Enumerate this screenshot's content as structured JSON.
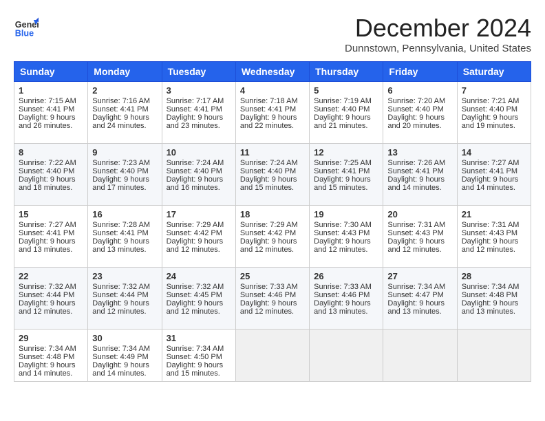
{
  "header": {
    "logo_general": "General",
    "logo_blue": "Blue",
    "month_title": "December 2024",
    "location": "Dunnstown, Pennsylvania, United States"
  },
  "days_of_week": [
    "Sunday",
    "Monday",
    "Tuesday",
    "Wednesday",
    "Thursday",
    "Friday",
    "Saturday"
  ],
  "weeks": [
    [
      {
        "day": "1",
        "sunrise": "7:15 AM",
        "sunset": "4:41 PM",
        "daylight": "9 hours and 26 minutes."
      },
      {
        "day": "2",
        "sunrise": "7:16 AM",
        "sunset": "4:41 PM",
        "daylight": "9 hours and 24 minutes."
      },
      {
        "day": "3",
        "sunrise": "7:17 AM",
        "sunset": "4:41 PM",
        "daylight": "9 hours and 23 minutes."
      },
      {
        "day": "4",
        "sunrise": "7:18 AM",
        "sunset": "4:41 PM",
        "daylight": "9 hours and 22 minutes."
      },
      {
        "day": "5",
        "sunrise": "7:19 AM",
        "sunset": "4:40 PM",
        "daylight": "9 hours and 21 minutes."
      },
      {
        "day": "6",
        "sunrise": "7:20 AM",
        "sunset": "4:40 PM",
        "daylight": "9 hours and 20 minutes."
      },
      {
        "day": "7",
        "sunrise": "7:21 AM",
        "sunset": "4:40 PM",
        "daylight": "9 hours and 19 minutes."
      }
    ],
    [
      {
        "day": "8",
        "sunrise": "7:22 AM",
        "sunset": "4:40 PM",
        "daylight": "9 hours and 18 minutes."
      },
      {
        "day": "9",
        "sunrise": "7:23 AM",
        "sunset": "4:40 PM",
        "daylight": "9 hours and 17 minutes."
      },
      {
        "day": "10",
        "sunrise": "7:24 AM",
        "sunset": "4:40 PM",
        "daylight": "9 hours and 16 minutes."
      },
      {
        "day": "11",
        "sunrise": "7:24 AM",
        "sunset": "4:40 PM",
        "daylight": "9 hours and 15 minutes."
      },
      {
        "day": "12",
        "sunrise": "7:25 AM",
        "sunset": "4:41 PM",
        "daylight": "9 hours and 15 minutes."
      },
      {
        "day": "13",
        "sunrise": "7:26 AM",
        "sunset": "4:41 PM",
        "daylight": "9 hours and 14 minutes."
      },
      {
        "day": "14",
        "sunrise": "7:27 AM",
        "sunset": "4:41 PM",
        "daylight": "9 hours and 14 minutes."
      }
    ],
    [
      {
        "day": "15",
        "sunrise": "7:27 AM",
        "sunset": "4:41 PM",
        "daylight": "9 hours and 13 minutes."
      },
      {
        "day": "16",
        "sunrise": "7:28 AM",
        "sunset": "4:41 PM",
        "daylight": "9 hours and 13 minutes."
      },
      {
        "day": "17",
        "sunrise": "7:29 AM",
        "sunset": "4:42 PM",
        "daylight": "9 hours and 12 minutes."
      },
      {
        "day": "18",
        "sunrise": "7:29 AM",
        "sunset": "4:42 PM",
        "daylight": "9 hours and 12 minutes."
      },
      {
        "day": "19",
        "sunrise": "7:30 AM",
        "sunset": "4:43 PM",
        "daylight": "9 hours and 12 minutes."
      },
      {
        "day": "20",
        "sunrise": "7:31 AM",
        "sunset": "4:43 PM",
        "daylight": "9 hours and 12 minutes."
      },
      {
        "day": "21",
        "sunrise": "7:31 AM",
        "sunset": "4:43 PM",
        "daylight": "9 hours and 12 minutes."
      }
    ],
    [
      {
        "day": "22",
        "sunrise": "7:32 AM",
        "sunset": "4:44 PM",
        "daylight": "9 hours and 12 minutes."
      },
      {
        "day": "23",
        "sunrise": "7:32 AM",
        "sunset": "4:44 PM",
        "daylight": "9 hours and 12 minutes."
      },
      {
        "day": "24",
        "sunrise": "7:32 AM",
        "sunset": "4:45 PM",
        "daylight": "9 hours and 12 minutes."
      },
      {
        "day": "25",
        "sunrise": "7:33 AM",
        "sunset": "4:46 PM",
        "daylight": "9 hours and 12 minutes."
      },
      {
        "day": "26",
        "sunrise": "7:33 AM",
        "sunset": "4:46 PM",
        "daylight": "9 hours and 13 minutes."
      },
      {
        "day": "27",
        "sunrise": "7:34 AM",
        "sunset": "4:47 PM",
        "daylight": "9 hours and 13 minutes."
      },
      {
        "day": "28",
        "sunrise": "7:34 AM",
        "sunset": "4:48 PM",
        "daylight": "9 hours and 13 minutes."
      }
    ],
    [
      {
        "day": "29",
        "sunrise": "7:34 AM",
        "sunset": "4:48 PM",
        "daylight": "9 hours and 14 minutes."
      },
      {
        "day": "30",
        "sunrise": "7:34 AM",
        "sunset": "4:49 PM",
        "daylight": "9 hours and 14 minutes."
      },
      {
        "day": "31",
        "sunrise": "7:34 AM",
        "sunset": "4:50 PM",
        "daylight": "9 hours and 15 minutes."
      },
      null,
      null,
      null,
      null
    ]
  ],
  "labels": {
    "sunrise": "Sunrise:",
    "sunset": "Sunset:",
    "daylight": "Daylight:"
  }
}
